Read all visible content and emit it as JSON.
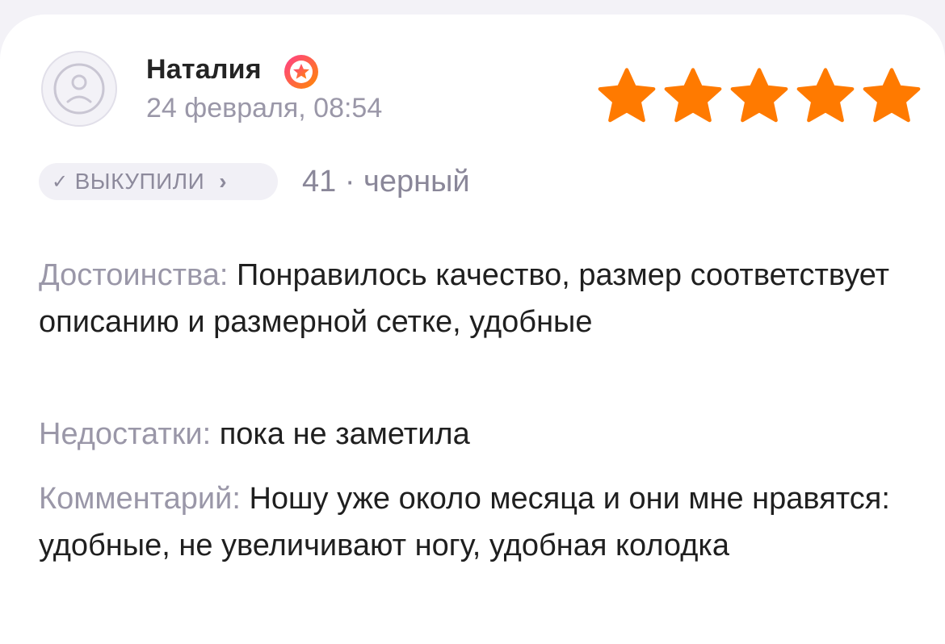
{
  "review": {
    "author": "Наталия",
    "date": "24 февраля, 08:54",
    "rating": 5,
    "purchase_badge": "ВЫКУПИЛИ",
    "variant": "41 · черный",
    "pros_label": "Достоинства:",
    "pros_text": "Понравилось качество, размер соответствует описанию и размерной сетке, удобные",
    "cons_label": "Недостатки:",
    "cons_text": "пока не заметила",
    "comment_label": "Комментарий:",
    "comment_text": "Ношу уже около месяца и они мне нравятся: удобные, не увеличивают ногу, удобная колодка"
  },
  "icons": {
    "avatar": "default-user-icon",
    "badge": "premium-star-badge-icon",
    "rating_star": "star-icon",
    "check": "check-icon",
    "chevron": "chevron-right-icon"
  },
  "colors": {
    "star": "#ff7a00",
    "badge_gradient_start": "#ff3d8b",
    "badge_gradient_end": "#ff8a00",
    "label_gray": "#9a97a8",
    "text": "#1f1f1f",
    "pill_bg": "#f1f0f6"
  }
}
